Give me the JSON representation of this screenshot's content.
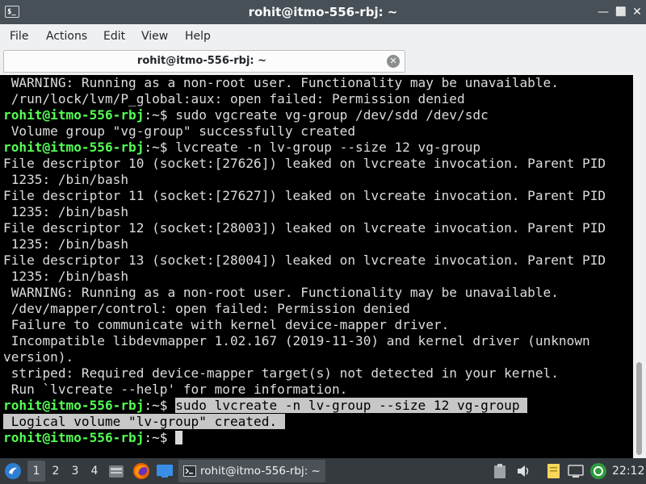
{
  "window": {
    "title": "rohit@itmo-556-rbj: ~",
    "app_icon_text": "$_",
    "controls": {
      "minimize": "—",
      "maximize": "⬜",
      "close": "✕"
    }
  },
  "menu": [
    "File",
    "Actions",
    "Edit",
    "View",
    "Help"
  ],
  "tab": {
    "label": "rohit@itmo-556-rbj: ~",
    "close_icon": "✕"
  },
  "terminal": {
    "prompt_user": "rohit@itmo-556-rbj",
    "prompt_path": ":~$ ",
    "lines": [
      {
        "prompt": false,
        "text": " WARNING: Running as a non-root user. Functionality may be unavailable."
      },
      {
        "prompt": false,
        "text": " /run/lock/lvm/P_global:aux: open failed: Permission denied"
      },
      {
        "prompt": true,
        "text": "sudo vgcreate vg-group /dev/sdd /dev/sdc"
      },
      {
        "prompt": false,
        "text": " Volume group \"vg-group\" successfully created"
      },
      {
        "prompt": true,
        "text": "lvcreate -n lv-group --size 12 vg-group"
      },
      {
        "prompt": false,
        "text": "File descriptor 10 (socket:[27626]) leaked on lvcreate invocation. Parent PID"
      },
      {
        "prompt": false,
        "text": " 1235: /bin/bash"
      },
      {
        "prompt": false,
        "text": "File descriptor 11 (socket:[27627]) leaked on lvcreate invocation. Parent PID"
      },
      {
        "prompt": false,
        "text": " 1235: /bin/bash"
      },
      {
        "prompt": false,
        "text": "File descriptor 12 (socket:[28003]) leaked on lvcreate invocation. Parent PID"
      },
      {
        "prompt": false,
        "text": " 1235: /bin/bash"
      },
      {
        "prompt": false,
        "text": "File descriptor 13 (socket:[28004]) leaked on lvcreate invocation. Parent PID"
      },
      {
        "prompt": false,
        "text": " 1235: /bin/bash"
      },
      {
        "prompt": false,
        "text": " WARNING: Running as a non-root user. Functionality may be unavailable."
      },
      {
        "prompt": false,
        "text": " /dev/mapper/control: open failed: Permission denied"
      },
      {
        "prompt": false,
        "text": " Failure to communicate with kernel device-mapper driver."
      },
      {
        "prompt": false,
        "text": " Incompatible libdevmapper 1.02.167 (2019-11-30) and kernel driver (unknown"
      },
      {
        "prompt": false,
        "text": "version)."
      },
      {
        "prompt": false,
        "text": " striped: Required device-mapper target(s) not detected in your kernel."
      },
      {
        "prompt": false,
        "text": " Run `lvcreate --help' for more information."
      }
    ],
    "selected_command": "sudo lvcreate -n lv-group --size 12 vg-group ",
    "selected_output": " Logical volume \"lv-group\" created. "
  },
  "taskbar": {
    "workspaces": [
      "1",
      "2",
      "3",
      "4"
    ],
    "active_workspace": "1",
    "task_label": "rohit@itmo-556-rbj: ~",
    "clock": "22:12"
  }
}
